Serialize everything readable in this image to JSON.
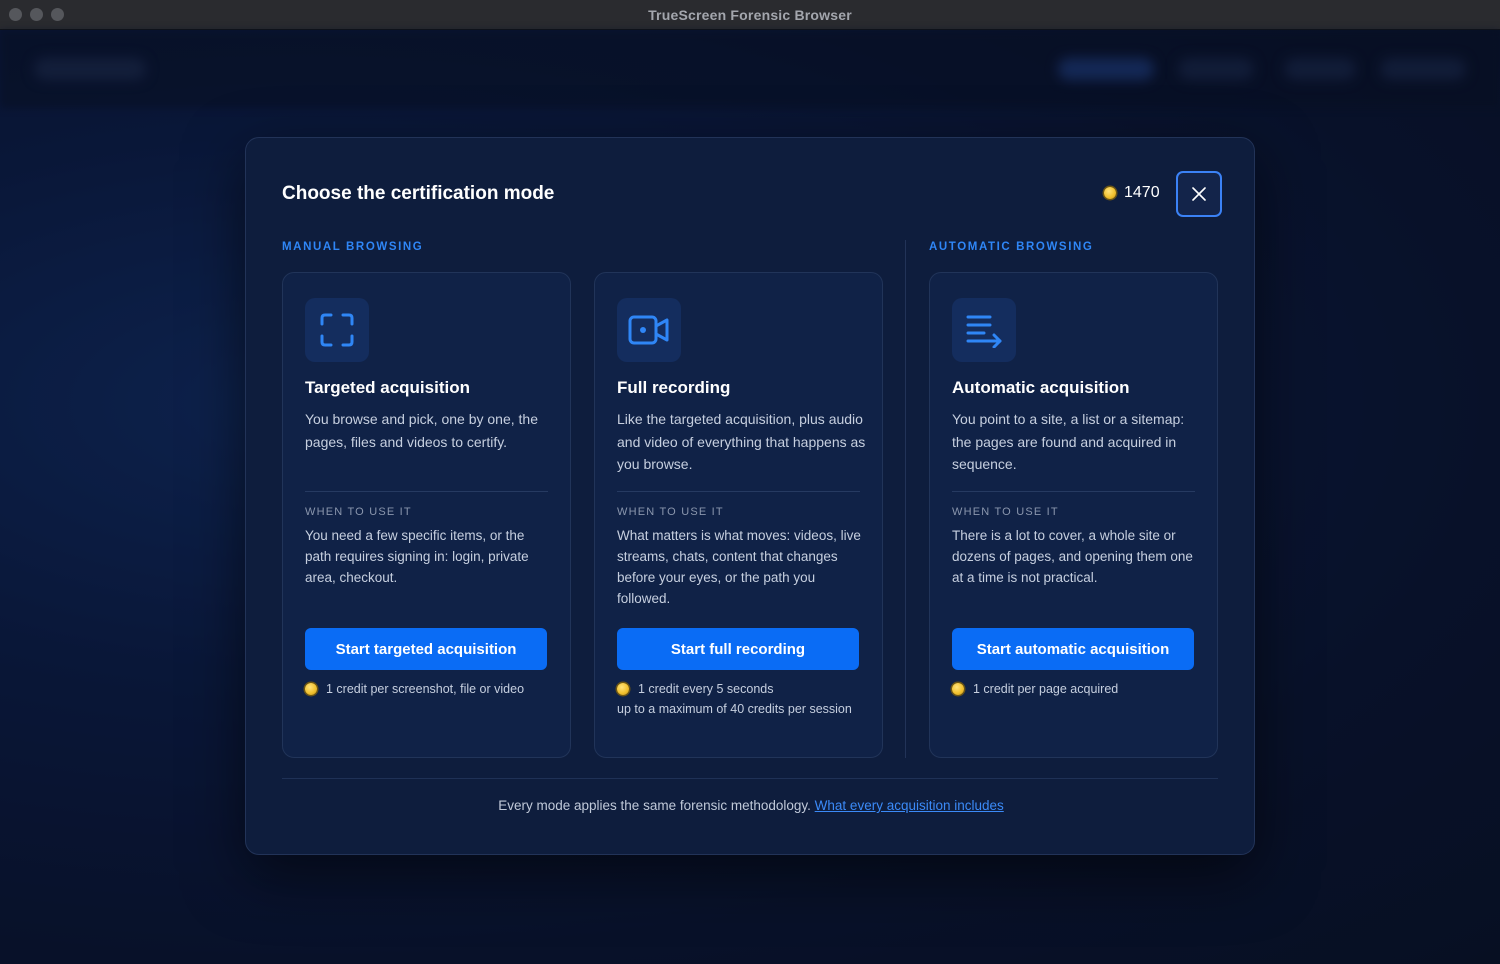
{
  "window": {
    "title": "TrueScreen Forensic Browser"
  },
  "modal": {
    "title": "Choose the certification mode",
    "credits": "1470",
    "close_icon": "close-icon"
  },
  "sections": {
    "manual": "MANUAL BROWSING",
    "automatic": "AUTOMATIC BROWSING"
  },
  "cards": [
    {
      "icon": "focus-frame-icon",
      "title": "Targeted acquisition",
      "description": "You browse and pick, one by one, the pages, files and videos to certify.",
      "when_label": "WHEN TO USE IT",
      "when_text": "You need a few specific items, or the path requires signing in: login, private area, checkout.",
      "button": "Start targeted acquisition",
      "cost_line1": "1 credit per screenshot, file or video",
      "cost_line2": ""
    },
    {
      "icon": "video-camera-icon",
      "title": "Full recording",
      "description": "Like the targeted acquisition, plus audio and video of everything that happens as you browse.",
      "when_label": "WHEN TO USE IT",
      "when_text": "What matters is what moves: videos, live streams, chats, content that changes before your eyes, or the path you followed.",
      "button": "Start full recording",
      "cost_line1": "1 credit every 5 seconds",
      "cost_line2": "up to a maximum of 40 credits per session"
    },
    {
      "icon": "list-arrow-icon",
      "title": "Automatic acquisition",
      "description": "You point to a site, a list or a sitemap: the pages are found and acquired in sequence.",
      "when_label": "WHEN TO USE IT",
      "when_text": "There is a lot to cover, a whole site or dozens of pages, and opening them one at a time is not practical.",
      "button": "Start automatic acquisition",
      "cost_line1": "1 credit per page acquired",
      "cost_line2": ""
    }
  ],
  "footer": {
    "text": "Every mode applies the same forensic methodology.",
    "link": "What every acquisition includes"
  },
  "colors": {
    "accent": "#0a6cf5",
    "section_label": "#2f86f6",
    "modal_bg": "#0e1d3d",
    "card_bg": "#102247",
    "coin": "#f2c230"
  }
}
